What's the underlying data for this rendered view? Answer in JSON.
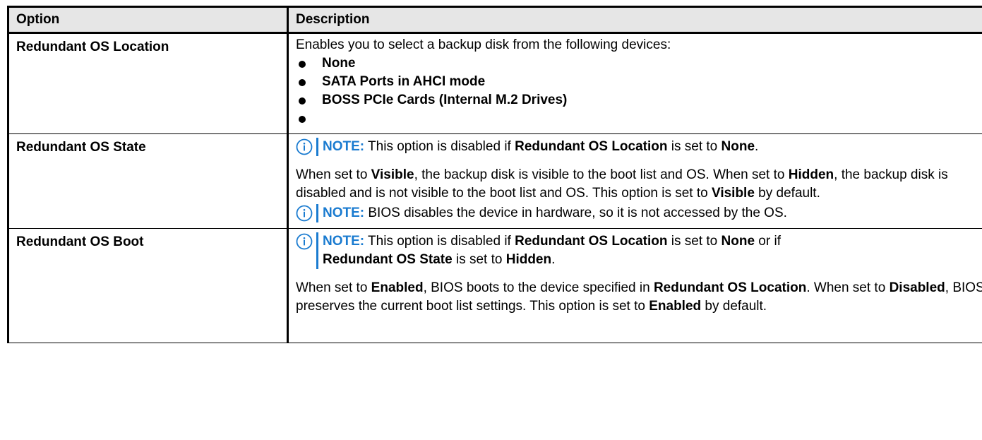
{
  "header": {
    "option": "Option",
    "description": "Description"
  },
  "rows": [
    {
      "option": "Redundant OS Location",
      "intro": "Enables you to select a backup disk from the following devices:",
      "bullets": [
        "None",
        "SATA Ports in AHCI mode",
        "BOSS PCIe Cards (Internal M.2 Drives)",
        ""
      ]
    },
    {
      "option": "Redundant OS State",
      "note1": {
        "label": "NOTE:",
        "t1": " This option is disabled if ",
        "b1": "Redundant OS Location",
        "t2": " is set to ",
        "b2": "None",
        "t3": "."
      },
      "para": {
        "t1": "When set to ",
        "b1": "Visible",
        "t2": ", the backup disk is visible to the boot list and OS. When set to ",
        "b2": "Hidden",
        "t3": ", the backup disk is disabled and is not visible to the boot list and OS. This option is set to ",
        "b3": "Visible",
        "t4": " by default."
      },
      "note2": {
        "label": "NOTE:",
        "text": " BIOS disables the device in hardware, so it is not accessed by the OS."
      }
    },
    {
      "option": "Redundant OS Boot",
      "note": {
        "label": "NOTE:",
        "t1": " This option is disabled if ",
        "b1": "Redundant OS Location",
        "t2": " is set to ",
        "b2": "None",
        "t3": " or if ",
        "b3": "Redundant OS State",
        "t4": " is set to ",
        "b4": "Hidden",
        "t5": "."
      },
      "para": {
        "t1": "When set to ",
        "b1": "Enabled",
        "t2": ", BIOS boots to the device specified in ",
        "b2": "Redundant OS Location",
        "t3": ". When set to ",
        "b3": "Disabled",
        "t4": ", BIOS preserves the current boot list settings. This option is set to ",
        "b4": "Enabled",
        "t5": " by default."
      }
    }
  ],
  "colors": {
    "note_accent": "#1a7bd0",
    "header_bg": "#e6e6e6"
  },
  "icons": {
    "note": "info-circle-icon"
  }
}
